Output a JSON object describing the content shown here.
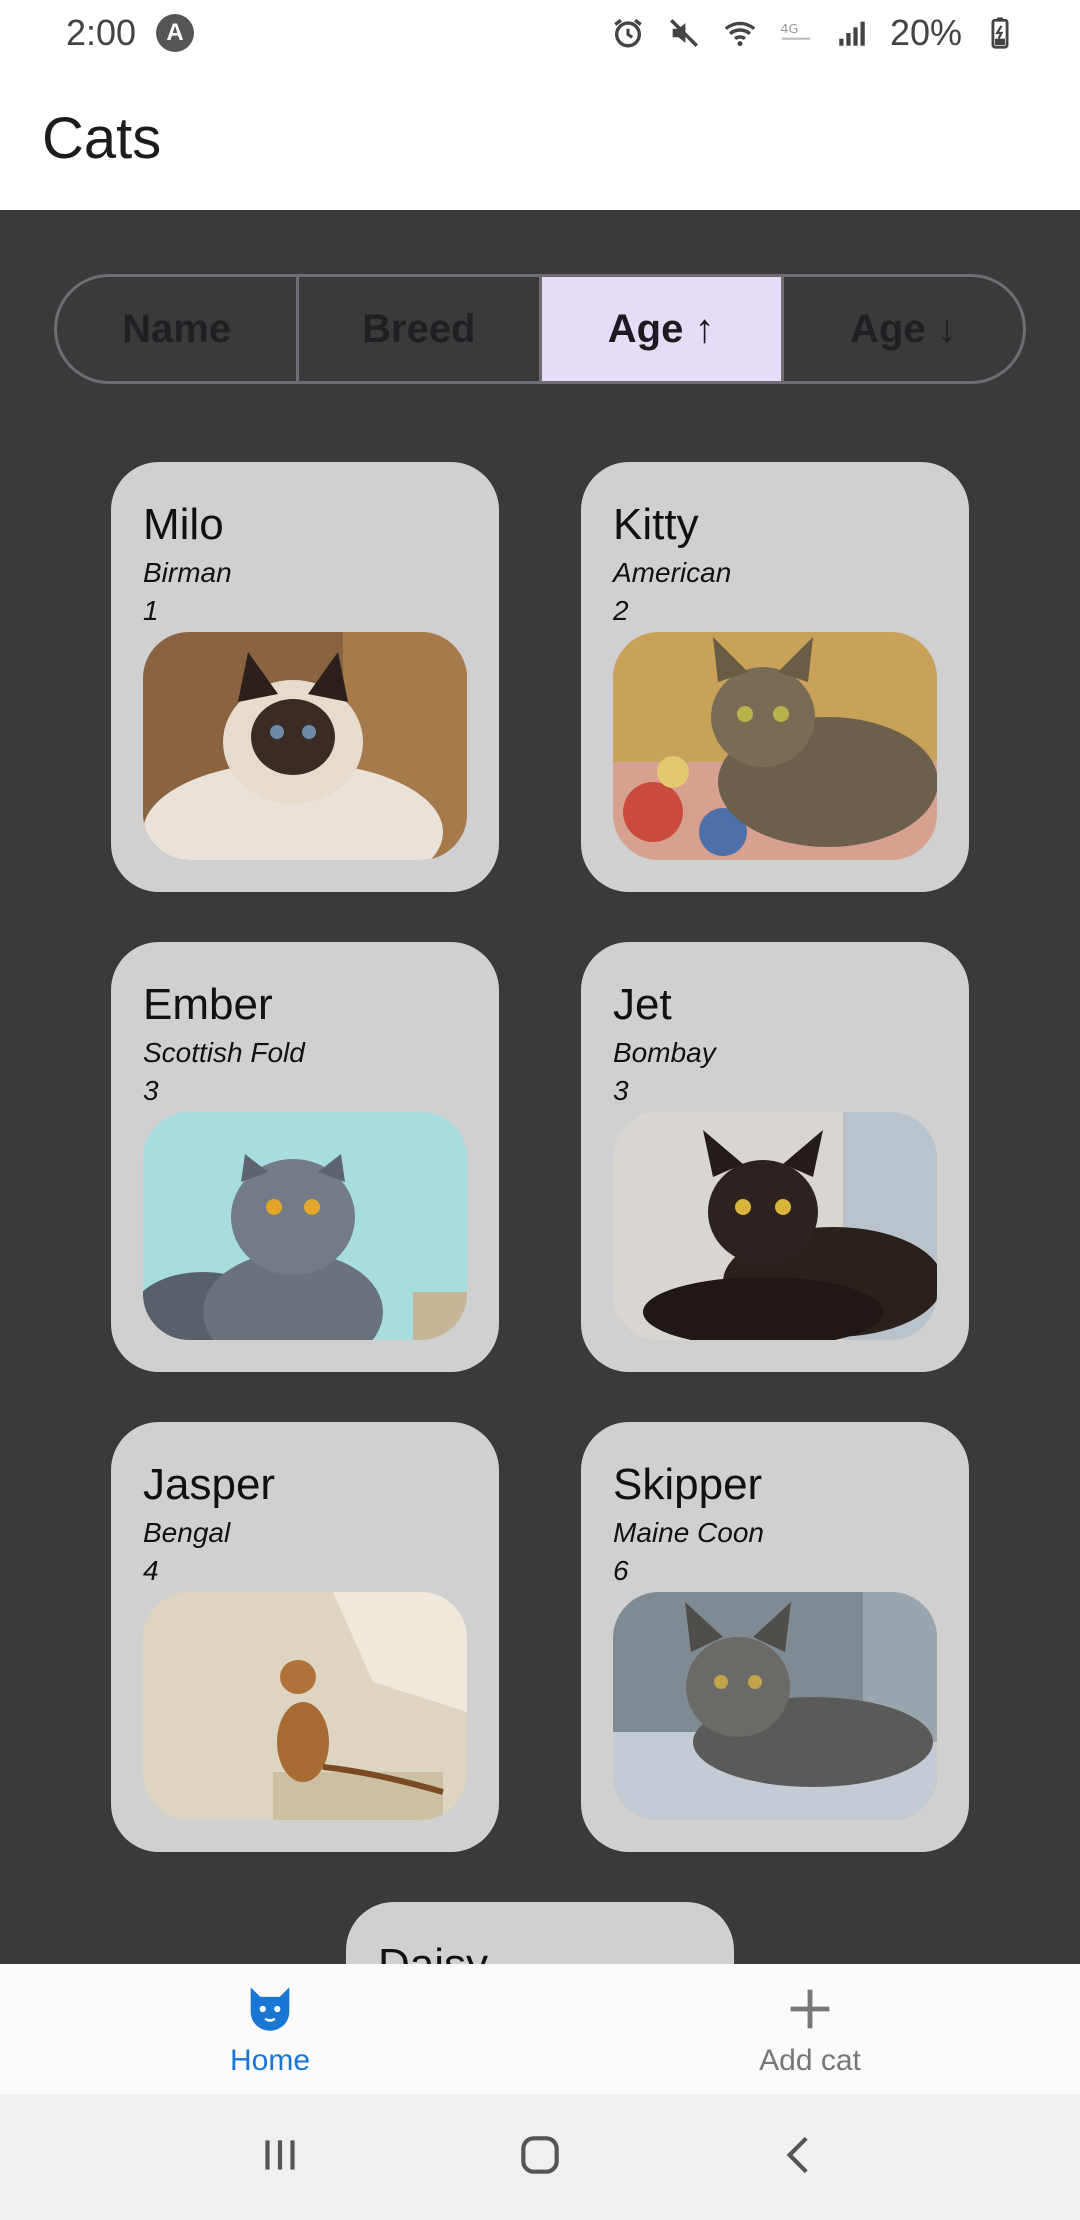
{
  "status_bar": {
    "time": "2:00",
    "notification_badge": "A",
    "battery_percent": "20%"
  },
  "app": {
    "title": "Cats"
  },
  "sort_options": [
    {
      "label": "Name",
      "active": false
    },
    {
      "label": "Breed",
      "active": false
    },
    {
      "label": "Age ↑",
      "active": true
    },
    {
      "label": "Age ↓",
      "active": false
    }
  ],
  "cats": [
    {
      "name": "Milo",
      "breed": "Birman",
      "age": "1"
    },
    {
      "name": "Kitty",
      "breed": "American",
      "age": "2"
    },
    {
      "name": "Ember",
      "breed": "Scottish Fold",
      "age": "3"
    },
    {
      "name": "Jet",
      "breed": "Bombay",
      "age": "3"
    },
    {
      "name": "Jasper",
      "breed": "Bengal",
      "age": "4"
    },
    {
      "name": "Skipper",
      "breed": "Maine Coon",
      "age": "6"
    },
    {
      "name": "Daisy"
    }
  ],
  "bottom_nav": {
    "home_label": "Home",
    "add_label": "Add cat"
  },
  "colors": {
    "content_bg": "#3a3a3a",
    "card_bg": "#d0d0d0",
    "active_segment": "#e7dcf7",
    "nav_active": "#1976d2"
  }
}
